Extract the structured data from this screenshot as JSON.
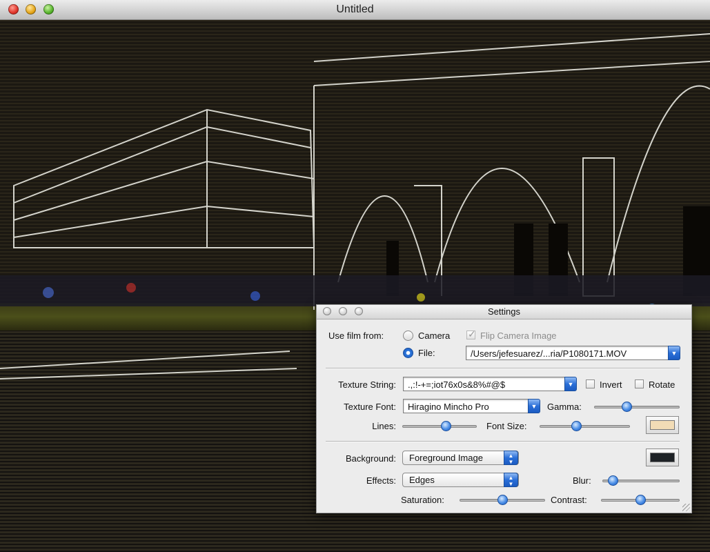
{
  "window": {
    "title": "Untitled"
  },
  "settings": {
    "title": "Settings",
    "use_film_from_label": "Use film from:",
    "camera_label": "Camera",
    "file_label": "File:",
    "source_selected": "File",
    "flip_label": "Flip Camera Image",
    "flip_checked": true,
    "flip_enabled": false,
    "file_path": "/Users/jefesuarez/...ria/P1080171.MOV",
    "texture_string_label": "Texture String:",
    "texture_string_value": " .,:!-+=;iot76x0s&8%#@$",
    "invert_label": "Invert",
    "invert_checked": false,
    "rotate_label": "Rotate",
    "rotate_checked": false,
    "texture_font_label": "Texture Font:",
    "texture_font_value": "Hiragino Mincho Pro",
    "gamma_label": "Gamma:",
    "gamma_value": 0.36,
    "lines_label": "Lines:",
    "lines_value": 0.6,
    "font_size_label": "Font Size:",
    "font_size_value": 0.39,
    "text_color": "#f2dcb6",
    "background_label": "Background:",
    "background_value": "Foreground Image",
    "background_color": "#1e2226",
    "effects_label": "Effects:",
    "effects_value": "Edges",
    "blur_label": "Blur:",
    "blur_value": 0.08,
    "saturation_label": "Saturation:",
    "saturation_value": 0.5,
    "contrast_label": "Contrast:",
    "contrast_value": 0.5
  }
}
